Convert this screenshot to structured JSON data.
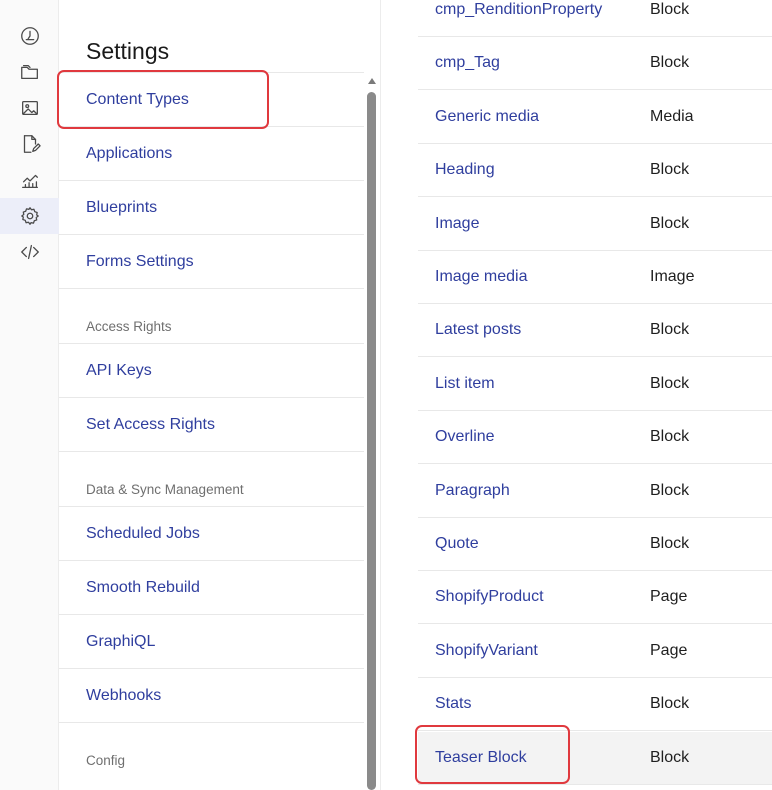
{
  "sidebar": {
    "icons": [
      {
        "name": "dashboard-icon"
      },
      {
        "name": "folder-icon"
      },
      {
        "name": "image-icon"
      },
      {
        "name": "edit-document-icon"
      },
      {
        "name": "analytics-icon"
      },
      {
        "name": "gear-icon",
        "active": true
      },
      {
        "name": "code-icon"
      }
    ]
  },
  "settings": {
    "title": "Settings",
    "items": [
      {
        "kind": "item",
        "label": "Content Types",
        "selected": true
      },
      {
        "kind": "item",
        "label": "Applications"
      },
      {
        "kind": "item",
        "label": "Blueprints"
      },
      {
        "kind": "item",
        "label": "Forms Settings"
      },
      {
        "kind": "group",
        "label": "Access Rights"
      },
      {
        "kind": "item",
        "label": "API Keys"
      },
      {
        "kind": "item",
        "label": "Set Access Rights"
      },
      {
        "kind": "group",
        "label": "Data & Sync Management"
      },
      {
        "kind": "item",
        "label": "Scheduled Jobs"
      },
      {
        "kind": "item",
        "label": "Smooth Rebuild"
      },
      {
        "kind": "item",
        "label": "GraphiQL"
      },
      {
        "kind": "item",
        "label": "Webhooks"
      },
      {
        "kind": "group-last",
        "label": "Config"
      }
    ]
  },
  "content_types": {
    "rows": [
      {
        "name": "cmp_RenditionProperty",
        "type": "Block"
      },
      {
        "name": "cmp_Tag",
        "type": "Block"
      },
      {
        "name": "Generic media",
        "type": "Media"
      },
      {
        "name": "Heading",
        "type": "Block"
      },
      {
        "name": "Image",
        "type": "Block"
      },
      {
        "name": "Image media",
        "type": "Image"
      },
      {
        "name": "Latest posts",
        "type": "Block"
      },
      {
        "name": "List item",
        "type": "Block"
      },
      {
        "name": "Overline",
        "type": "Block"
      },
      {
        "name": "Paragraph",
        "type": "Block"
      },
      {
        "name": "Quote",
        "type": "Block"
      },
      {
        "name": "ShopifyProduct",
        "type": "Page"
      },
      {
        "name": "ShopifyVariant",
        "type": "Page"
      },
      {
        "name": "Stats",
        "type": "Block"
      },
      {
        "name": "Teaser Block",
        "type": "Block",
        "hover": true
      }
    ]
  },
  "colors": {
    "link": "#2f3e9e",
    "highlight": "#e0393e",
    "active_rail": "#eceef9"
  }
}
